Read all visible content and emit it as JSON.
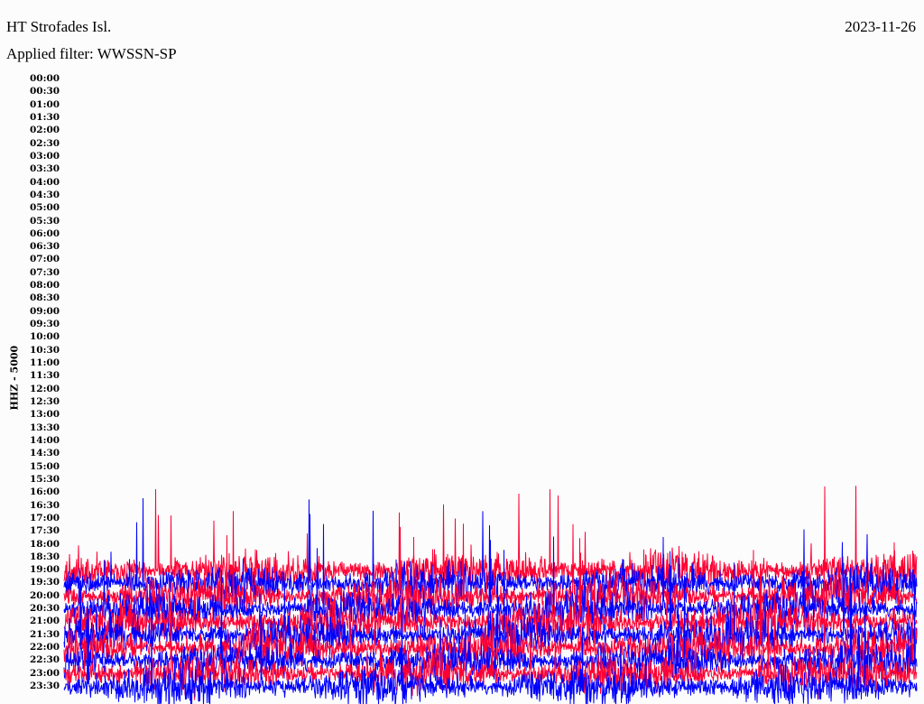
{
  "header": {
    "station": "HT Strofades Isl.",
    "date": "2023-11-26",
    "filter": "Applied filter: WWSSN-SP"
  },
  "chart_data": {
    "type": "line",
    "title": "HT Strofades Isl.",
    "ylabel": "HHZ - 5000",
    "xlabel": "",
    "row_labels": [
      "00:00",
      "00:30",
      "01:00",
      "01:30",
      "02:00",
      "02:30",
      "03:00",
      "03:30",
      "04:00",
      "04:30",
      "05:00",
      "05:30",
      "06:00",
      "06:30",
      "07:00",
      "07:30",
      "08:00",
      "08:30",
      "09:00",
      "09:30",
      "10:00",
      "10:30",
      "11:00",
      "11:30",
      "12:00",
      "12:30",
      "13:00",
      "13:30",
      "14:00",
      "14:30",
      "15:00",
      "15:30",
      "16:00",
      "16:30",
      "17:00",
      "17:30",
      "18:00",
      "18:30",
      "19:00",
      "19:30",
      "20:00",
      "20:30",
      "21:00",
      "21:30",
      "22:00",
      "22:30",
      "23:00",
      "23:30"
    ],
    "rows_with_data": [
      "19:00",
      "19:30",
      "20:00",
      "20:30",
      "21:00",
      "21:30",
      "22:00",
      "22:30",
      "23:00",
      "23:30"
    ],
    "series_colors": [
      "#ff0033",
      "#0000ff"
    ],
    "minutes_per_row": 30,
    "grid": false
  }
}
